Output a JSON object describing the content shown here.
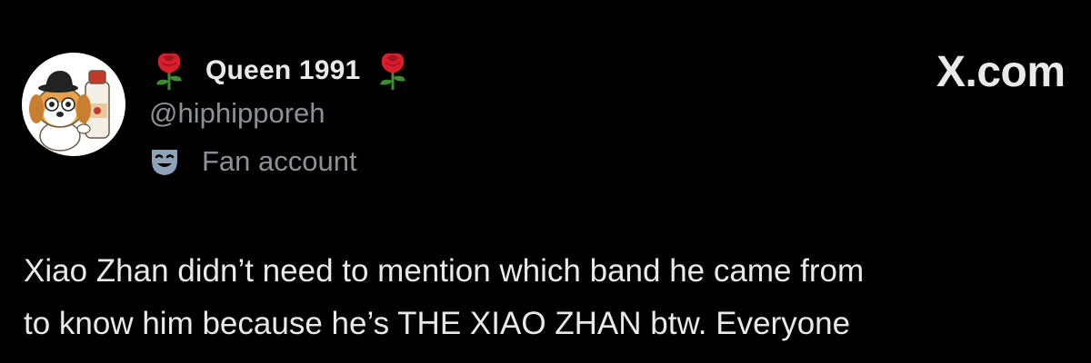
{
  "profile": {
    "display_name": "Queen 1991",
    "name_emoji_left": "rose-emoji",
    "name_emoji_right": "rose-emoji",
    "handle": "@hiphipporeh",
    "account_label_icon": "theater-mask-icon",
    "account_label": "Fan account",
    "avatar": "avatar-cartoon-dog-with-milk-bottle"
  },
  "site": {
    "mark": "X.com"
  },
  "tweet": {
    "lines": [
      "Xiao Zhan didn’t need to mention which band he came from",
      "to know him because he’s THE XIAO ZHAN btw. Everyone"
    ]
  },
  "colors": {
    "background": "#000000",
    "primary_text": "#e7e9ea",
    "secondary_text": "#8b9198"
  }
}
